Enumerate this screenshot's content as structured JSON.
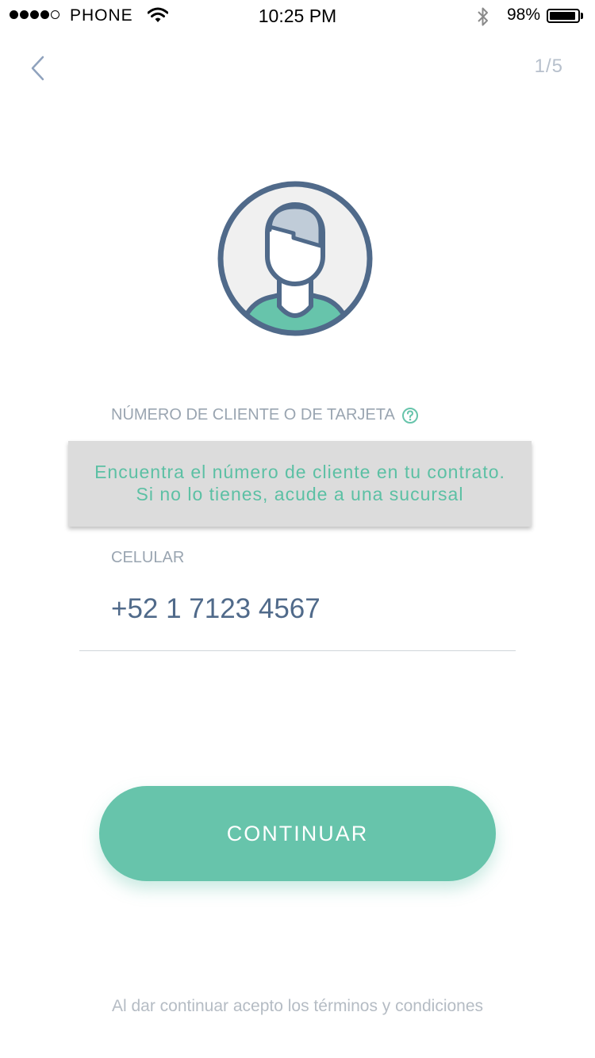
{
  "status_bar": {
    "carrier": "PHONE",
    "time": "10:25 PM",
    "battery_percent": "98%",
    "signal_bars_filled": 4,
    "signal_bars_total": 5
  },
  "header": {
    "back_icon": "chevron-left-icon",
    "step": "1/5"
  },
  "avatar": {
    "icon": "user-avatar-icon",
    "colors": {
      "outline": "#506a8a",
      "background": "#f0f0f0",
      "hair": "#c0ccd8",
      "shirt": "#67c4ab"
    }
  },
  "form": {
    "client_label": "NÚMERO DE CLIENTE O DE TARJETA",
    "help_icon": "question-circle-icon",
    "tooltip_line1": "Encuentra el número de cliente en tu contrato.",
    "tooltip_line2": "Si no lo tienes, acude a una sucursal",
    "phone_label": "CELULAR",
    "phone_value": "+52 1 7123 4567"
  },
  "actions": {
    "continue_label": "CONTINUAR"
  },
  "footer": {
    "terms": "Al dar continuar acepto los términos y condiciones"
  },
  "colors": {
    "accent": "#67c4ab",
    "text_primary": "#506a8a",
    "label": "#9aa5b1",
    "tooltip_bg": "#dcdcdc"
  }
}
